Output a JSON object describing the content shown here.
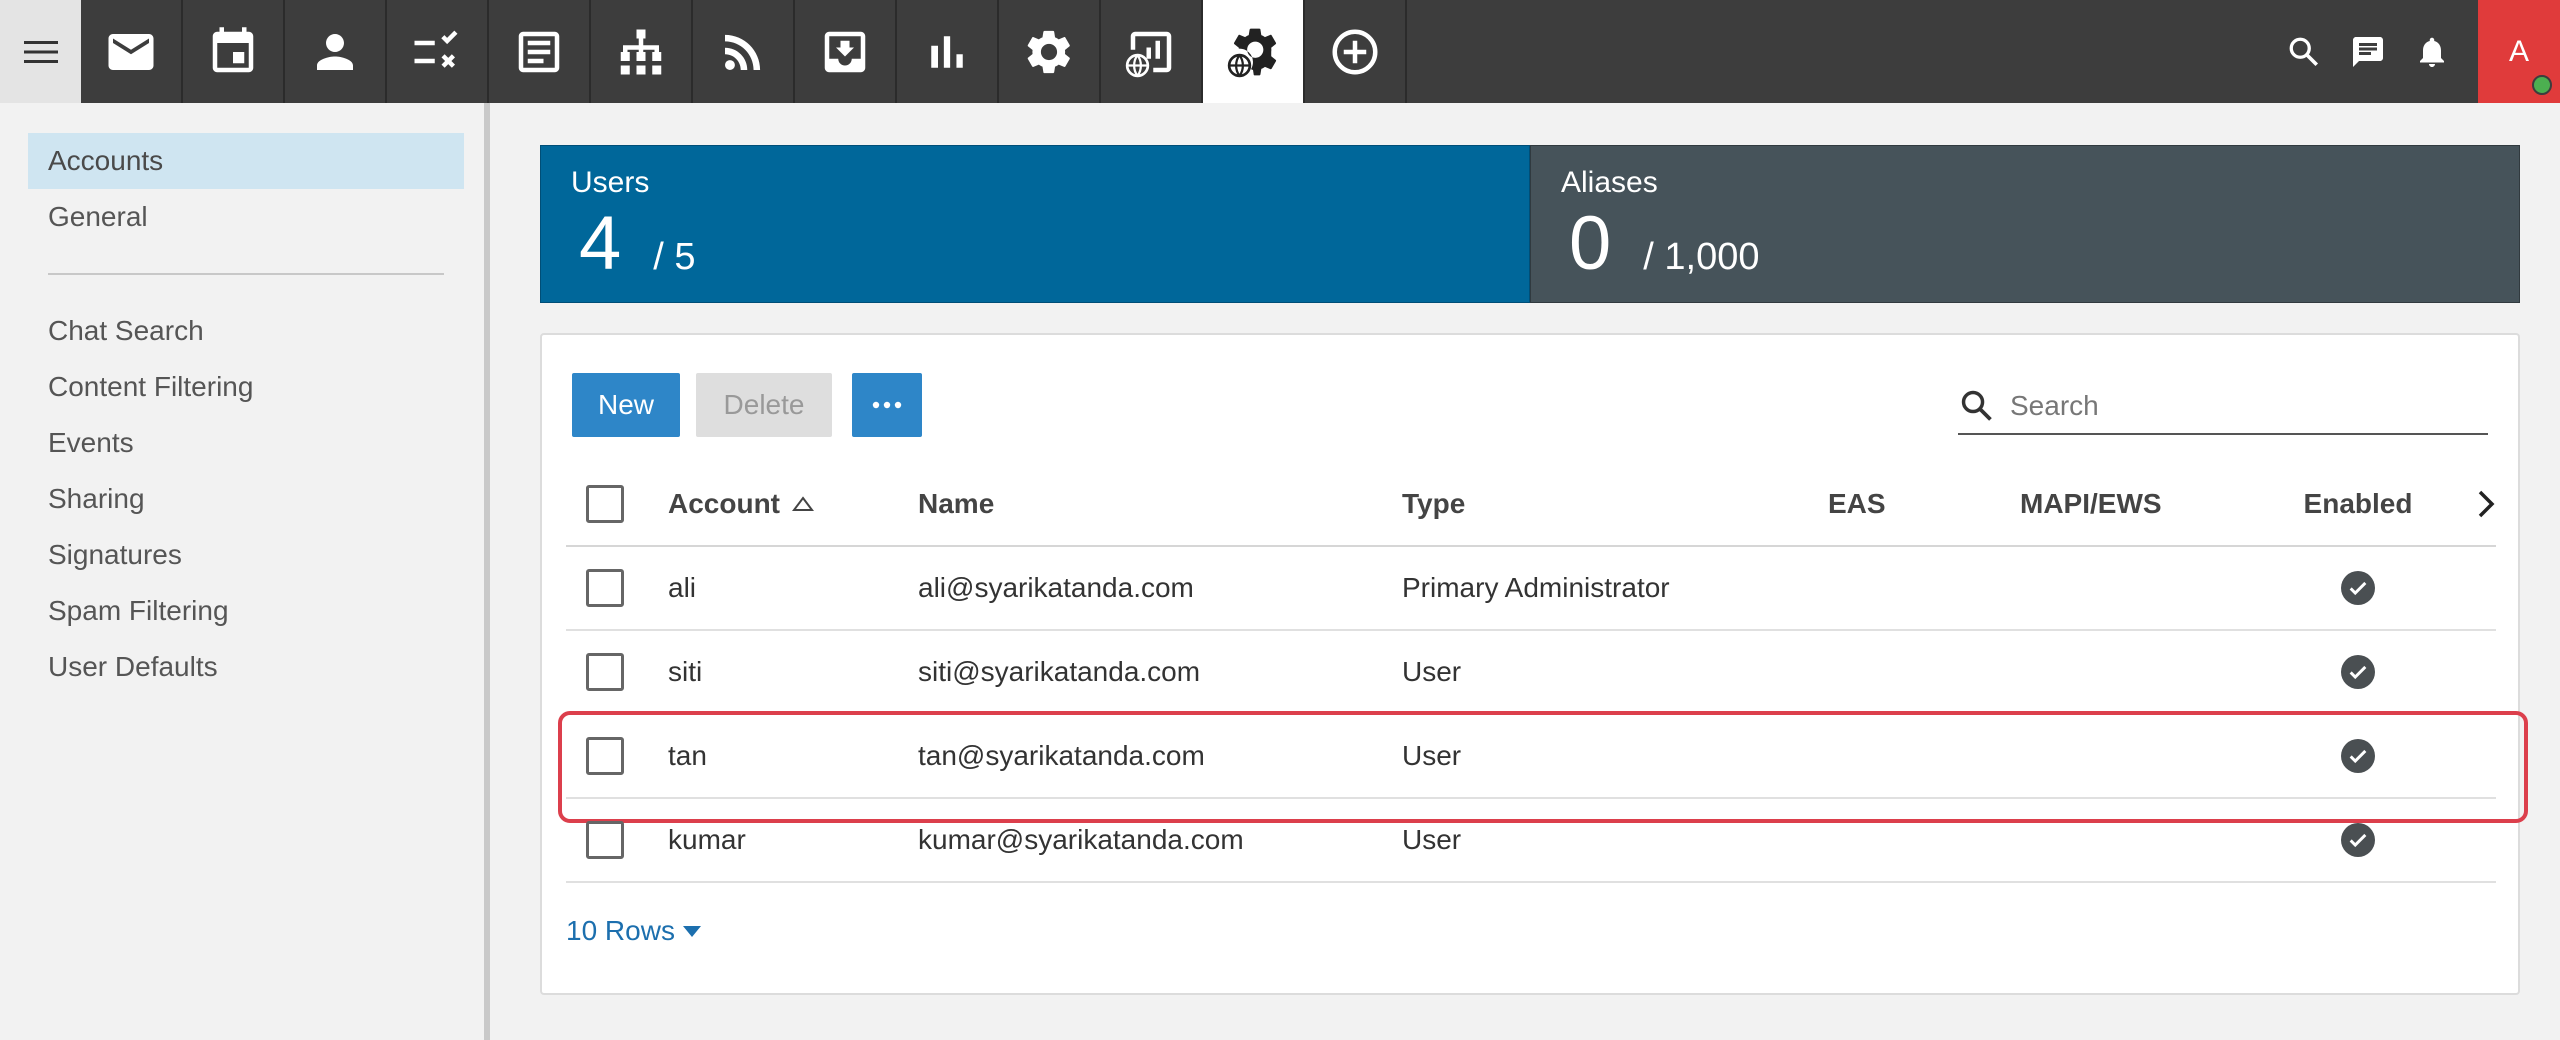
{
  "topbar": {
    "apps": [
      {
        "icon": "mail-icon",
        "name": "mail"
      },
      {
        "icon": "calendar-icon",
        "name": "calendar"
      },
      {
        "icon": "contacts-icon",
        "name": "contacts"
      },
      {
        "icon": "tasks-icon",
        "name": "tasks"
      },
      {
        "icon": "notes-icon",
        "name": "notes"
      },
      {
        "icon": "domain-tree-icon",
        "name": "domain-tree"
      },
      {
        "icon": "rss-icon",
        "name": "rss"
      },
      {
        "icon": "inbox-download-icon",
        "name": "inbox-download"
      },
      {
        "icon": "reports-icon",
        "name": "reports"
      },
      {
        "icon": "settings-icon",
        "name": "settings"
      },
      {
        "icon": "domain-reports-icon",
        "name": "domain-reports"
      },
      {
        "icon": "domain-settings-icon",
        "name": "domain-settings",
        "active": true
      },
      {
        "icon": "add-circle-icon",
        "name": "add"
      }
    ],
    "avatar_letter": "A"
  },
  "sidebar": {
    "items": [
      {
        "label": "Accounts",
        "selected": true
      },
      {
        "label": "General"
      }
    ],
    "items2": [
      {
        "label": "Chat Search"
      },
      {
        "label": "Content Filtering"
      },
      {
        "label": "Events"
      },
      {
        "label": "Sharing"
      },
      {
        "label": "Signatures"
      },
      {
        "label": "Spam Filtering"
      },
      {
        "label": "User Defaults"
      }
    ]
  },
  "stats": {
    "users": {
      "label": "Users",
      "value": "4",
      "limit": "/ 5"
    },
    "aliases": {
      "label": "Aliases",
      "value": "0",
      "limit": "/ 1,000"
    }
  },
  "toolbar": {
    "new_label": "New",
    "delete_label": "Delete",
    "more_label": "•••",
    "search_placeholder": "Search"
  },
  "table": {
    "columns": {
      "account": "Account",
      "name": "Name",
      "type": "Type",
      "eas": "EAS",
      "mapi": "MAPI/EWS",
      "enabled": "Enabled"
    },
    "rows": [
      {
        "account": "ali",
        "name": "ali@syarikatanda.com",
        "type": "Primary Administrator",
        "enabled": true
      },
      {
        "account": "siti",
        "name": "siti@syarikatanda.com",
        "type": "User",
        "enabled": true
      },
      {
        "account": "tan",
        "name": "tan@syarikatanda.com",
        "type": "User",
        "enabled": true,
        "highlighted": true
      },
      {
        "account": "kumar",
        "name": "kumar@syarikatanda.com",
        "type": "User",
        "enabled": true
      }
    ]
  },
  "footer": {
    "rows_label": "10 Rows"
  },
  "colors": {
    "topbar": "#3d3d3d",
    "users_tile": "#00679a",
    "aliases_tile": "#46535a",
    "primary_button": "#2e86c8",
    "highlight_border": "#dc3f4c",
    "avatar": "#e03b3b"
  }
}
